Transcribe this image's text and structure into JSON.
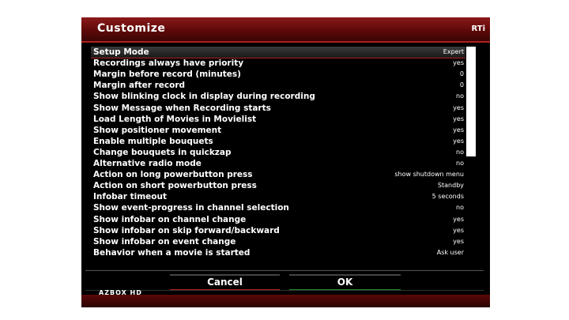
{
  "header": {
    "title": "Customize",
    "logo": "RTi"
  },
  "settings": [
    {
      "label": "Setup Mode",
      "value": "Expert"
    },
    {
      "label": "Recordings always have priority",
      "value": "yes"
    },
    {
      "label": "Margin before record (minutes)",
      "value": "0"
    },
    {
      "label": "Margin after record",
      "value": "0"
    },
    {
      "label": "Show blinking clock in display during recording",
      "value": "no"
    },
    {
      "label": "Show Message when Recording starts",
      "value": "yes"
    },
    {
      "label": "Load Length of Movies in Movielist",
      "value": "yes"
    },
    {
      "label": "Show positioner movement",
      "value": "yes"
    },
    {
      "label": "Enable multiple bouquets",
      "value": "yes"
    },
    {
      "label": "Change bouquets in quickzap",
      "value": "no"
    },
    {
      "label": "Alternative radio mode",
      "value": "no"
    },
    {
      "label": "Action on long powerbutton press",
      "value": "show shutdown menu"
    },
    {
      "label": "Action on short powerbutton press",
      "value": "Standby"
    },
    {
      "label": "Infobar timeout",
      "value": "5 seconds"
    },
    {
      "label": "Show event-progress in channel selection",
      "value": "no"
    },
    {
      "label": "Show infobar on channel change",
      "value": "yes"
    },
    {
      "label": "Show infobar on skip forward/backward",
      "value": "yes"
    },
    {
      "label": "Show infobar on event change",
      "value": "yes"
    },
    {
      "label": "Behavior when a movie is started",
      "value": "Ask user"
    }
  ],
  "selected_index": 0,
  "scroll": {
    "visible_fraction": 0.52
  },
  "buttons": {
    "cancel": "Cancel",
    "ok": "OK"
  },
  "footer": {
    "brand": "AZBOX HD"
  },
  "colors": {
    "accent_red": "#b02020",
    "ok_green": "#1f8a2a",
    "title_bg": "#8a1a1a"
  }
}
